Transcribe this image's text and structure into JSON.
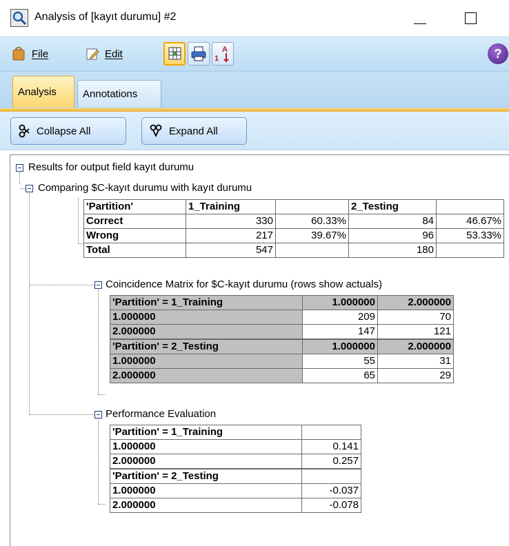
{
  "window": {
    "title": "Analysis of [kayıt durumu] #2"
  },
  "menu": {
    "file": "File",
    "edit": "Edit"
  },
  "tabs": {
    "analysis": "Analysis",
    "annotations": "Annotations"
  },
  "actions": {
    "collapse_all": "Collapse All",
    "expand_all": "Expand All"
  },
  "tree": {
    "root": "Results for output field kayıt durumu",
    "comparing": "Comparing $C-kayıt durumu with kayıt durumu",
    "coincidence": "Coincidence Matrix for $C-kayıt durumu (rows show actuals)",
    "performance": "Performance Evaluation"
  },
  "comparison_table": {
    "header": [
      "'Partition'",
      "1_Training",
      "",
      "2_Testing",
      ""
    ],
    "rows": [
      [
        "Correct",
        "330",
        "60.33%",
        "84",
        "46.67%"
      ],
      [
        "Wrong",
        "217",
        "39.67%",
        "96",
        "53.33%"
      ],
      [
        "Total",
        "547",
        "",
        "180",
        ""
      ]
    ]
  },
  "coincidence_training": {
    "header": [
      "'Partition' = 1_Training",
      "1.000000",
      "2.000000"
    ],
    "rows": [
      [
        "1.000000",
        "209",
        "70"
      ],
      [
        "2.000000",
        "147",
        "121"
      ]
    ]
  },
  "coincidence_testing": {
    "header": [
      "'Partition' = 2_Testing",
      "1.000000",
      "2.000000"
    ],
    "rows": [
      [
        "1.000000",
        "55",
        "31"
      ],
      [
        "2.000000",
        "65",
        "29"
      ]
    ]
  },
  "performance_training": {
    "header": [
      "'Partition' = 1_Training",
      ""
    ],
    "rows": [
      [
        "1.000000",
        "0.141"
      ],
      [
        "2.000000",
        "0.257"
      ]
    ]
  },
  "performance_testing": {
    "header": [
      "'Partition' = 2_Testing",
      ""
    ],
    "rows": [
      [
        "1.000000",
        "-0.037"
      ],
      [
        "2.000000",
        "-0.078"
      ]
    ]
  }
}
